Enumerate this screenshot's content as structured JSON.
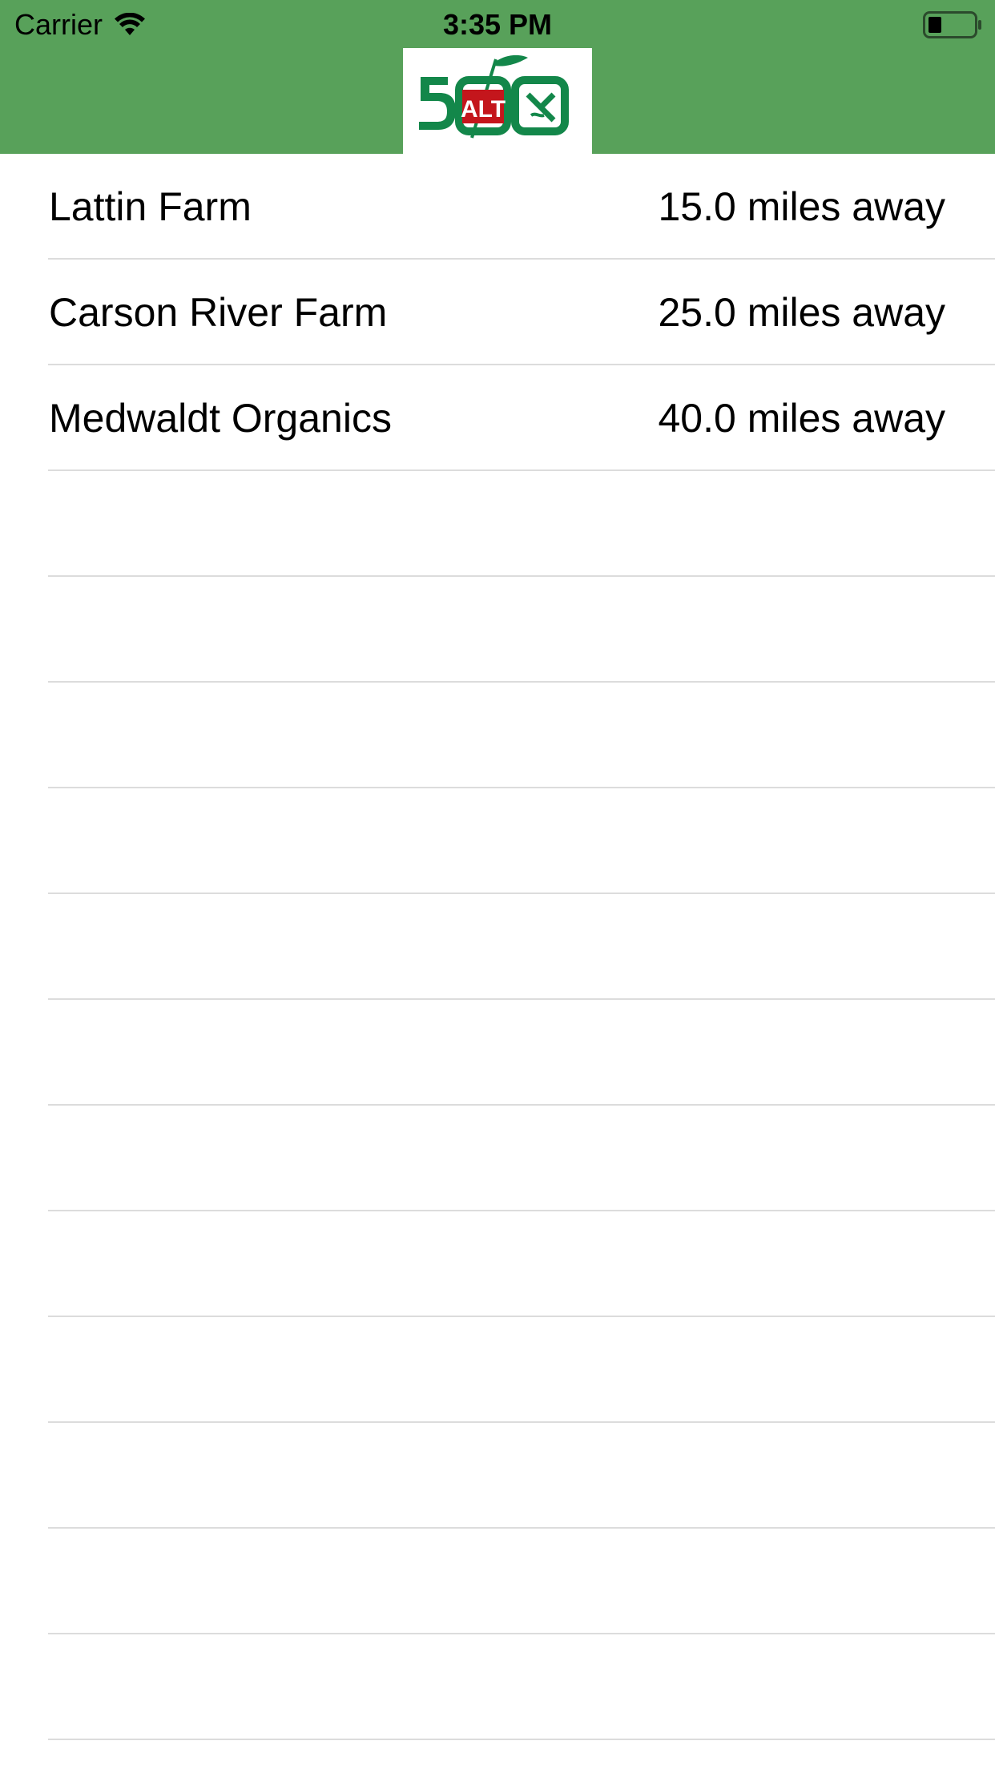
{
  "status_bar": {
    "carrier": "Carrier",
    "time": "3:35 PM",
    "wifi_icon": "wifi-icon",
    "battery_icon": "battery-low-icon"
  },
  "nav": {
    "logo_icon": "alt-500-logo",
    "logo_text": "ALT",
    "logo_number": "500",
    "header_color": "#58a15a"
  },
  "farms": [
    {
      "name": "Lattin Farm",
      "distance": "15.0 miles away"
    },
    {
      "name": "Carson River Farm",
      "distance": "25.0 miles away"
    },
    {
      "name": "Medwaldt Organics",
      "distance": "40.0 miles away"
    },
    {
      "name": "",
      "distance": ""
    },
    {
      "name": "",
      "distance": ""
    },
    {
      "name": "",
      "distance": ""
    },
    {
      "name": "",
      "distance": ""
    },
    {
      "name": "",
      "distance": ""
    },
    {
      "name": "",
      "distance": ""
    },
    {
      "name": "",
      "distance": ""
    },
    {
      "name": "",
      "distance": ""
    },
    {
      "name": "",
      "distance": ""
    },
    {
      "name": "",
      "distance": ""
    },
    {
      "name": "",
      "distance": ""
    },
    {
      "name": "",
      "distance": ""
    },
    {
      "name": "",
      "distance": ""
    }
  ]
}
